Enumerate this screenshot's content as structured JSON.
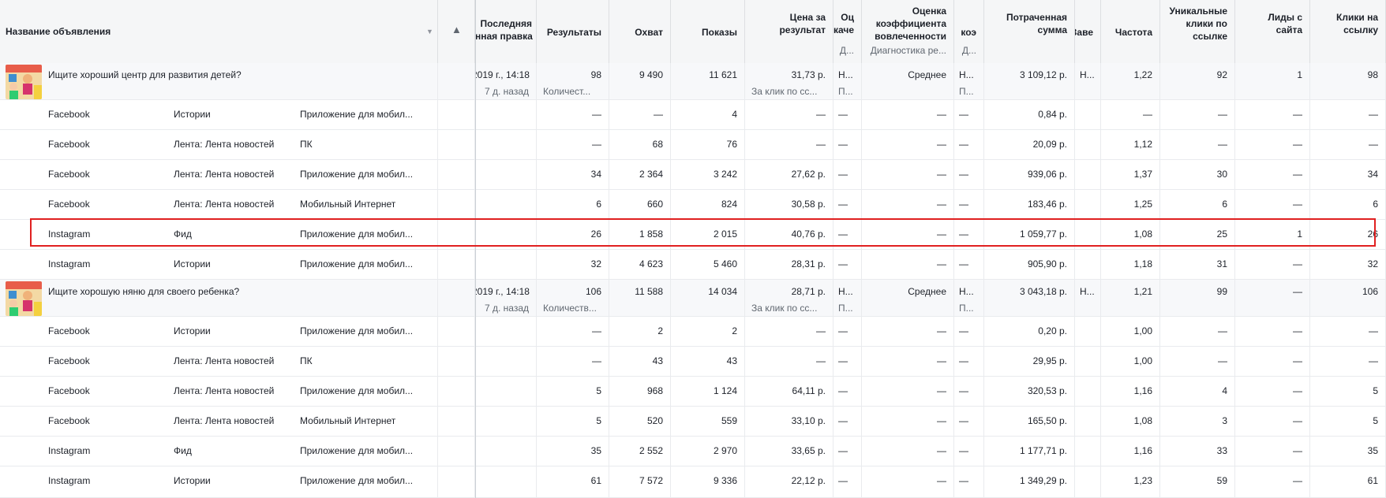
{
  "header": {
    "name_col": "Название объявления",
    "columns": [
      {
        "key": "last_edit",
        "title": "Последняя\nнная правка",
        "sub": ""
      },
      {
        "key": "results",
        "title": "Результаты",
        "sub": ""
      },
      {
        "key": "reach",
        "title": "Охват",
        "sub": ""
      },
      {
        "key": "impressions",
        "title": "Показы",
        "sub": ""
      },
      {
        "key": "cpr",
        "title": "Цена за\nрезультат",
        "sub": ""
      },
      {
        "key": "quality",
        "title": "Оц\nкаче",
        "sub": "Д..."
      },
      {
        "key": "engagement",
        "title": "Оценка\nкоэффициента\nвовлеченности",
        "sub": "Диагностика ре..."
      },
      {
        "key": "conv",
        "title": "коэ",
        "sub": "Д..."
      },
      {
        "key": "spent",
        "title": "Потраченная\nсумма",
        "sub": ""
      },
      {
        "key": "end",
        "title": "Заве",
        "sub": ""
      },
      {
        "key": "freq",
        "title": "Частота",
        "sub": ""
      },
      {
        "key": "unique_clicks",
        "title": "Уникальные\nклики по\nссылке",
        "sub": ""
      },
      {
        "key": "leads",
        "title": "Лиды с\nсайта",
        "sub": ""
      },
      {
        "key": "link_clicks",
        "title": "Клики на\nссылку",
        "sub": ""
      }
    ]
  },
  "rows": [
    {
      "type": "parent",
      "title": "Ищите хороший центр для развития детей?",
      "v": [
        "2019 г., 14:18",
        "98",
        "9 490",
        "11 621",
        "31,73 р.",
        "Н...",
        "Среднее",
        "Н...",
        "3 109,12 р.",
        "Н...",
        "1,22",
        "92",
        "1",
        "98"
      ],
      "s": [
        "7 д. назад",
        "Количест...",
        "",
        "",
        "За клик по сс...",
        "П...",
        "",
        "П...",
        "",
        "",
        "",
        "",
        "",
        ""
      ]
    },
    {
      "type": "child",
      "p": "Facebook",
      "pl": "Истории",
      "d": "Приложение для мобил...",
      "v": [
        "",
        "—",
        "—",
        "4",
        "—",
        "—",
        "—",
        "—",
        "0,84 р.",
        "",
        "—",
        "—",
        "—",
        "—"
      ]
    },
    {
      "type": "child",
      "p": "Facebook",
      "pl": "Лента: Лента новостей",
      "d": "ПК",
      "v": [
        "",
        "—",
        "68",
        "76",
        "—",
        "—",
        "—",
        "—",
        "20,09 р.",
        "",
        "1,12",
        "—",
        "—",
        "—"
      ]
    },
    {
      "type": "child",
      "p": "Facebook",
      "pl": "Лента: Лента новостей",
      "d": "Приложение для мобил...",
      "v": [
        "",
        "34",
        "2 364",
        "3 242",
        "27,62 р.",
        "—",
        "—",
        "—",
        "939,06 р.",
        "",
        "1,37",
        "30",
        "—",
        "34"
      ]
    },
    {
      "type": "child",
      "p": "Facebook",
      "pl": "Лента: Лента новостей",
      "d": "Мобильный Интернет",
      "v": [
        "",
        "6",
        "660",
        "824",
        "30,58 р.",
        "—",
        "—",
        "—",
        "183,46 р.",
        "",
        "1,25",
        "6",
        "—",
        "6"
      ]
    },
    {
      "type": "child",
      "p": "Instagram",
      "pl": "Фид",
      "d": "Приложение для мобил...",
      "v": [
        "",
        "26",
        "1 858",
        "2 015",
        "40,76 р.",
        "—",
        "—",
        "—",
        "1 059,77 р.",
        "",
        "1,08",
        "25",
        "1",
        "26"
      ]
    },
    {
      "type": "child",
      "p": "Instagram",
      "pl": "Истории",
      "d": "Приложение для мобил...",
      "v": [
        "",
        "32",
        "4 623",
        "5 460",
        "28,31 р.",
        "—",
        "—",
        "—",
        "905,90 р.",
        "",
        "1,18",
        "31",
        "—",
        "32"
      ]
    },
    {
      "type": "parent",
      "title": "Ищите хорошую няню для своего ребенка?",
      "v": [
        "2019 г., 14:18",
        "106",
        "11 588",
        "14 034",
        "28,71 р.",
        "Н...",
        "Среднее",
        "Н...",
        "3 043,18 р.",
        "Н...",
        "1,21",
        "99",
        "—",
        "106"
      ],
      "s": [
        "7 д. назад",
        "Количеств...",
        "",
        "",
        "За клик по сс...",
        "П...",
        "",
        "П...",
        "",
        "",
        "",
        "",
        "",
        ""
      ]
    },
    {
      "type": "child",
      "p": "Facebook",
      "pl": "Истории",
      "d": "Приложение для мобил...",
      "v": [
        "",
        "—",
        "2",
        "2",
        "—",
        "—",
        "—",
        "—",
        "0,20 р.",
        "",
        "1,00",
        "—",
        "—",
        "—"
      ]
    },
    {
      "type": "child",
      "p": "Facebook",
      "pl": "Лента: Лента новостей",
      "d": "ПК",
      "v": [
        "",
        "—",
        "43",
        "43",
        "—",
        "—",
        "—",
        "—",
        "29,95 р.",
        "",
        "1,00",
        "—",
        "—",
        "—"
      ]
    },
    {
      "type": "child",
      "p": "Facebook",
      "pl": "Лента: Лента новостей",
      "d": "Приложение для мобил...",
      "v": [
        "",
        "5",
        "968",
        "1 124",
        "64,11 р.",
        "—",
        "—",
        "—",
        "320,53 р.",
        "",
        "1,16",
        "4",
        "—",
        "5"
      ]
    },
    {
      "type": "child",
      "p": "Facebook",
      "pl": "Лента: Лента новостей",
      "d": "Мобильный Интернет",
      "v": [
        "",
        "5",
        "520",
        "559",
        "33,10 р.",
        "—",
        "—",
        "—",
        "165,50 р.",
        "",
        "1,08",
        "3",
        "—",
        "5"
      ]
    },
    {
      "type": "child",
      "p": "Instagram",
      "pl": "Фид",
      "d": "Приложение для мобил...",
      "v": [
        "",
        "35",
        "2 552",
        "2 970",
        "33,65 р.",
        "—",
        "—",
        "—",
        "1 177,71 р.",
        "",
        "1,16",
        "33",
        "—",
        "35"
      ]
    },
    {
      "type": "child",
      "p": "Instagram",
      "pl": "Истории",
      "d": "Приложение для мобил...",
      "v": [
        "",
        "61",
        "7 572",
        "9 336",
        "22,12 р.",
        "—",
        "—",
        "—",
        "1 349,29 р.",
        "",
        "1,23",
        "59",
        "—",
        "61"
      ]
    }
  ],
  "colors": {
    "header_bg": "#f5f6f7",
    "border": "#dddfe2",
    "highlight": "#e02020",
    "subtext": "#606770"
  },
  "icons": {
    "sort": "chevron-down-icon",
    "warning": "warning-icon"
  }
}
